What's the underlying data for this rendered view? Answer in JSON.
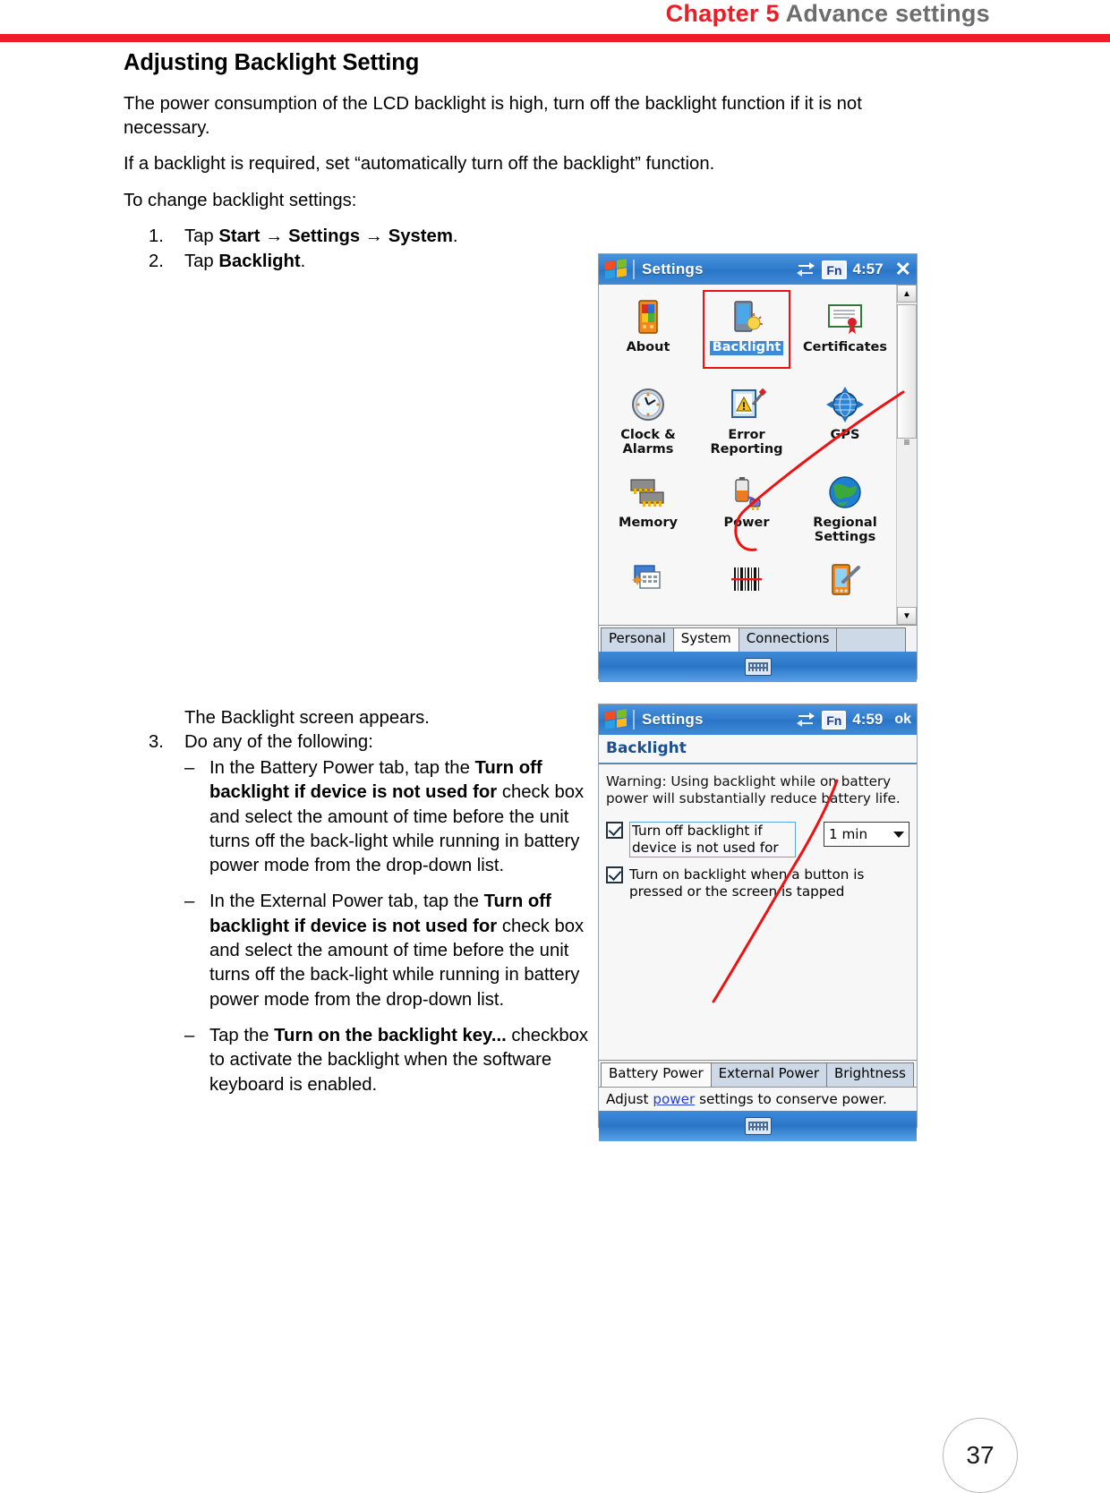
{
  "header": {
    "chapter": "Chapter 5",
    "subtitle": "Advance settings",
    "chapter_color": "#ee1c25",
    "subtitle_color": "#6d6d6d",
    "rule_color": "#ee1c25"
  },
  "section": {
    "title": "Adjusting Backlight Setting",
    "paragraphs": [
      "The power consumption of the LCD backlight is high, turn off the backlight function if it is not necessary.",
      "If a backlight is required, set “automatically turn off the backlight” function.",
      "To change backlight settings:"
    ]
  },
  "steps": [
    {
      "num": "1.",
      "pre": "Tap ",
      "bold1": "Start",
      "arrow1": " → ",
      "bold2": "Settings",
      "arrow2": " → ",
      "bold3": "System",
      "post": "."
    },
    {
      "num": "2.",
      "pre": "Tap ",
      "bold1": "Backlight",
      "post": "."
    }
  ],
  "note_after_step2": "The Backlight screen appears.",
  "step3": {
    "num": "3.",
    "label": "Do any of the following:",
    "bullets": [
      {
        "dash": "–",
        "pre": "In the Battery Power tab, tap the ",
        "bold": "Turn off backlight if device is not used for",
        "post": " check box and select the amount of time before the unit turns off the back-light while running in battery power mode from the drop-down list."
      },
      {
        "dash": "–",
        "pre": "In the External Power tab, tap the ",
        "bold": "Turn off backlight if device is not used for",
        "post": " check box and select the amount of time before the unit turns off the back-light while running in battery power mode from the drop-down list."
      },
      {
        "dash": "–",
        "pre": "Tap the ",
        "bold": "Turn on the backlight key...",
        "post": " checkbox to activate the backlight when the software keyboard is enabled."
      }
    ]
  },
  "screenshot_settings": {
    "titlebar": {
      "app": "Settings",
      "fn": "Fn",
      "time": "4:57",
      "close": "✕"
    },
    "icons": [
      {
        "label": "About",
        "icon": "pda-device-icon",
        "selected": false
      },
      {
        "label": "Backlight",
        "icon": "backlight-icon",
        "selected": true
      },
      {
        "label": "Certificates",
        "icon": "certificate-icon",
        "selected": false
      },
      {
        "label": "Clock &\nAlarms",
        "icon": "clock-icon",
        "selected": false
      },
      {
        "label": "Error\nReporting",
        "icon": "error-reporting-icon",
        "selected": false
      },
      {
        "label": "GPS",
        "icon": "gps-globe-icon",
        "selected": false
      },
      {
        "label": "Memory",
        "icon": "memory-chips-icon",
        "selected": false
      },
      {
        "label": "Power",
        "icon": "power-battery-icon",
        "selected": false
      },
      {
        "label": "Regional\nSettings",
        "icon": "world-globe-icon",
        "selected": false
      },
      {
        "label": "",
        "icon": "calendar-cards-icon",
        "selected": false
      },
      {
        "label": "",
        "icon": "barcode-icon",
        "selected": false
      },
      {
        "label": "",
        "icon": "stylus-pda-icon",
        "selected": false
      }
    ],
    "tabs": [
      {
        "label": "Personal",
        "active": false
      },
      {
        "label": "System",
        "active": true
      },
      {
        "label": "Connections",
        "active": false
      }
    ],
    "highlight_color": "#ee1111",
    "selected_label_bg": "#3d8ad6"
  },
  "screenshot_backlight": {
    "titlebar": {
      "app": "Settings",
      "fn": "Fn",
      "time": "4:59",
      "ok": "ok"
    },
    "page_title": "Backlight",
    "warning": "Warning: Using backlight while on battery power will substantially reduce battery life.",
    "checkboxes": [
      {
        "checked": true,
        "label": "Turn off backlight if device is not used for",
        "focused": true
      },
      {
        "checked": true,
        "label": "Turn on backlight when a button is pressed or the screen is tapped",
        "focused": false
      }
    ],
    "dropdown": {
      "value": "1 min"
    },
    "tabs": [
      {
        "label": "Battery Power",
        "active": true
      },
      {
        "label": "External Power",
        "active": false
      },
      {
        "label": "Brightness",
        "active": false
      }
    ],
    "status": {
      "pre": "Adjust ",
      "link": "power",
      "post": " settings to conserve power."
    }
  },
  "page_number": "37"
}
